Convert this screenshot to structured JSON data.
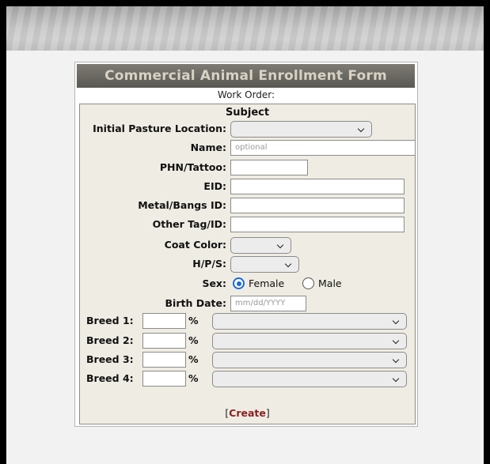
{
  "form": {
    "title": "Commercial Animal Enrollment Form",
    "work_order_label": "Work Order:",
    "section_title": "Subject",
    "fields": {
      "pasture_label": "Initial Pasture Location:",
      "name_label": "Name:",
      "name_placeholder": "optional",
      "phn_label": "PHN/Tattoo:",
      "eid_label": "EID:",
      "metal_label": "Metal/Bangs ID:",
      "other_tag_label": "Other Tag/ID:",
      "coat_label": "Coat Color:",
      "hps_label": "H/P/S:",
      "sex_label": "Sex:",
      "sex_options": [
        "Female",
        "Male"
      ],
      "sex_selected": "Female",
      "birth_label": "Birth Date:",
      "birth_placeholder": "mm/dd/YYYY"
    },
    "breeds": [
      {
        "label": "Breed 1:",
        "pct": "%"
      },
      {
        "label": "Breed 2:",
        "pct": "%"
      },
      {
        "label": "Breed 3:",
        "pct": "%"
      },
      {
        "label": "Breed 4:",
        "pct": "%"
      }
    ],
    "create": {
      "open": "[",
      "label": "Create",
      "close": "]"
    }
  }
}
